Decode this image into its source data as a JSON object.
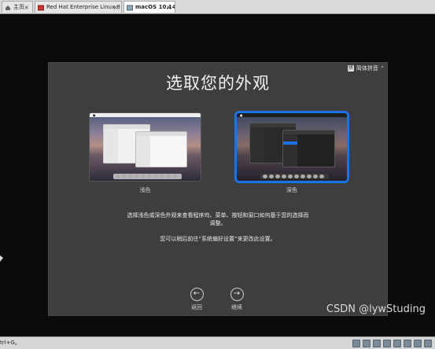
{
  "tabs": [
    {
      "label": "主页",
      "icon": "home-icon"
    },
    {
      "label": "Red Hat Enterprise Linux 8 64...",
      "icon": "vm-icon"
    },
    {
      "label": "macOS 10.14",
      "icon": "vm-icon"
    }
  ],
  "setup": {
    "language_label": "简体拼音",
    "title": "选取您的外观",
    "options": [
      {
        "label": "浅色"
      },
      {
        "label": "深色"
      }
    ],
    "description_line1": "选择浅色或深色外观来查看程序坞、菜单、按钮和窗口如何基于您的选择而",
    "description_line2": "调整。",
    "description_note": "您可以稍后前往“系统偏好设置”来更改此设置。",
    "back_label": "返回",
    "continue_label": "继续"
  },
  "watermark": "CSDN @lywStuding",
  "status": {
    "hint": "trl+G。"
  },
  "colors": {
    "accent": "#1a73e8",
    "panel": "#3e3e3e"
  }
}
